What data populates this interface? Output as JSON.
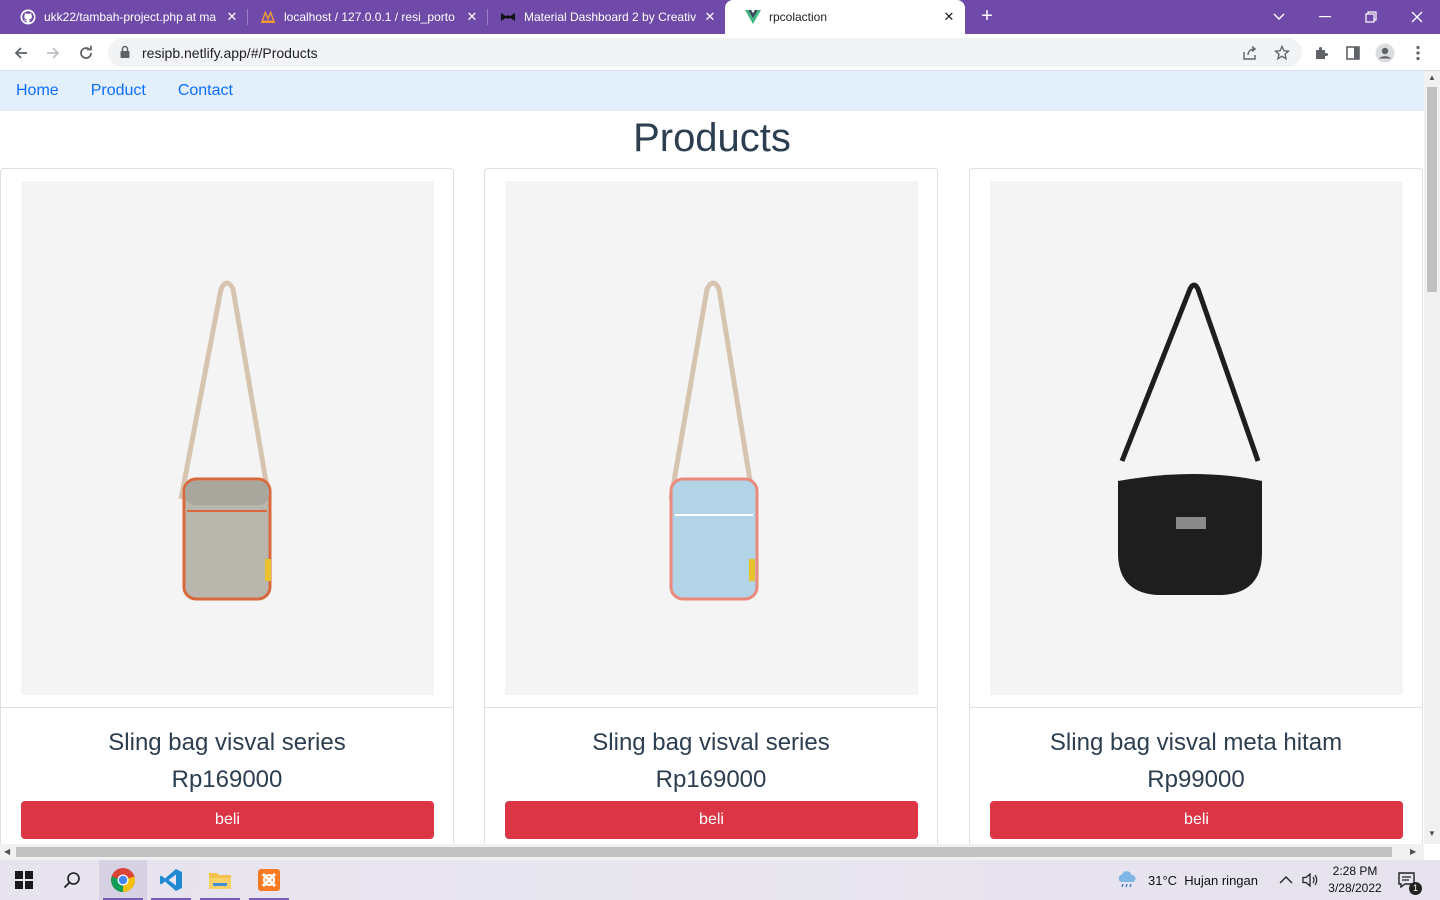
{
  "browser": {
    "tabs": [
      {
        "title": "ukk22/tambah-project.php at ma",
        "icon": "github-icon",
        "active": false
      },
      {
        "title": "localhost / 127.0.0.1 / resi_porto",
        "icon": "phpmyadmin-icon",
        "active": false
      },
      {
        "title": "Material Dashboard 2 by Creative",
        "icon": "creative-tim-icon",
        "active": false
      },
      {
        "title": "rpcolaction",
        "icon": "vue-icon",
        "active": true
      }
    ],
    "url": "resipb.netlify.app/#/Products"
  },
  "nav": {
    "home": "Home",
    "product": "Product",
    "contact": "Contact"
  },
  "page": {
    "title": "Products",
    "products": [
      {
        "name": "Sling bag visval series",
        "price": "Rp169000",
        "button": "beli",
        "bag_color": "#b9b6ae",
        "trim_color": "#d9693c"
      },
      {
        "name": "Sling bag visval series",
        "price": "Rp169000",
        "button": "beli",
        "bag_color": "#b3d3e6",
        "trim_color": "#e98a7d"
      },
      {
        "name": "Sling bag visval meta hitam",
        "price": "Rp99000",
        "button": "beli",
        "bag_color": "#1e1e1e",
        "trim_color": "#1e1e1e"
      }
    ]
  },
  "taskbar": {
    "weather": "31°C  Hujan ringan",
    "time": "2:28 PM",
    "date": "3/28/2022",
    "notification_count": "1"
  },
  "colors": {
    "tabstrip": "#6f4aa8",
    "nav_bg": "#e3f0fb",
    "link": "#0d6efd",
    "buy_button": "#dc3545"
  }
}
